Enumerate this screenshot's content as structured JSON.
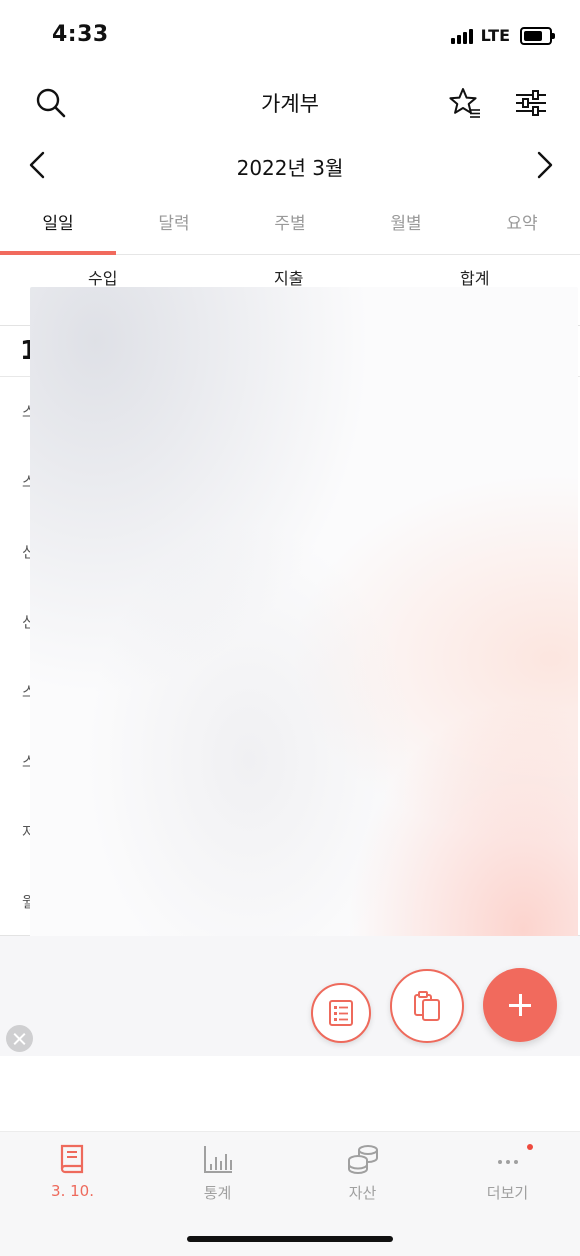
{
  "status_bar": {
    "time": "4:33",
    "network": "LTE"
  },
  "header": {
    "title": "가계부"
  },
  "month_nav": {
    "label": "2022년 3월"
  },
  "tabs": [
    {
      "label": "일일",
      "active": true
    },
    {
      "label": "달력"
    },
    {
      "label": "주별"
    },
    {
      "label": "월별"
    },
    {
      "label": "요약"
    }
  ],
  "summary_columns": {
    "income": "수입",
    "expense": "지출",
    "total": "합계"
  },
  "date_row": {
    "day_partial": "1"
  },
  "transactions": [
    {
      "label_partial": "스"
    },
    {
      "label_partial": "스"
    },
    {
      "label_partial": "신"
    },
    {
      "label_partial": "신"
    },
    {
      "label_partial": "스"
    },
    {
      "label_partial": "스"
    },
    {
      "label_partial": "저축"
    },
    {
      "label_partial": "월급"
    }
  ],
  "bottom_nav": [
    {
      "label": "3. 10.",
      "icon": "book-icon",
      "active": true
    },
    {
      "label": "통계",
      "icon": "bar-chart-icon"
    },
    {
      "label": "자산",
      "icon": "coins-icon"
    },
    {
      "label": "더보기",
      "icon": "more-icon",
      "badge": true
    }
  ],
  "colors": {
    "accent": "#f16a5d",
    "inactive": "#a0a0a0"
  }
}
